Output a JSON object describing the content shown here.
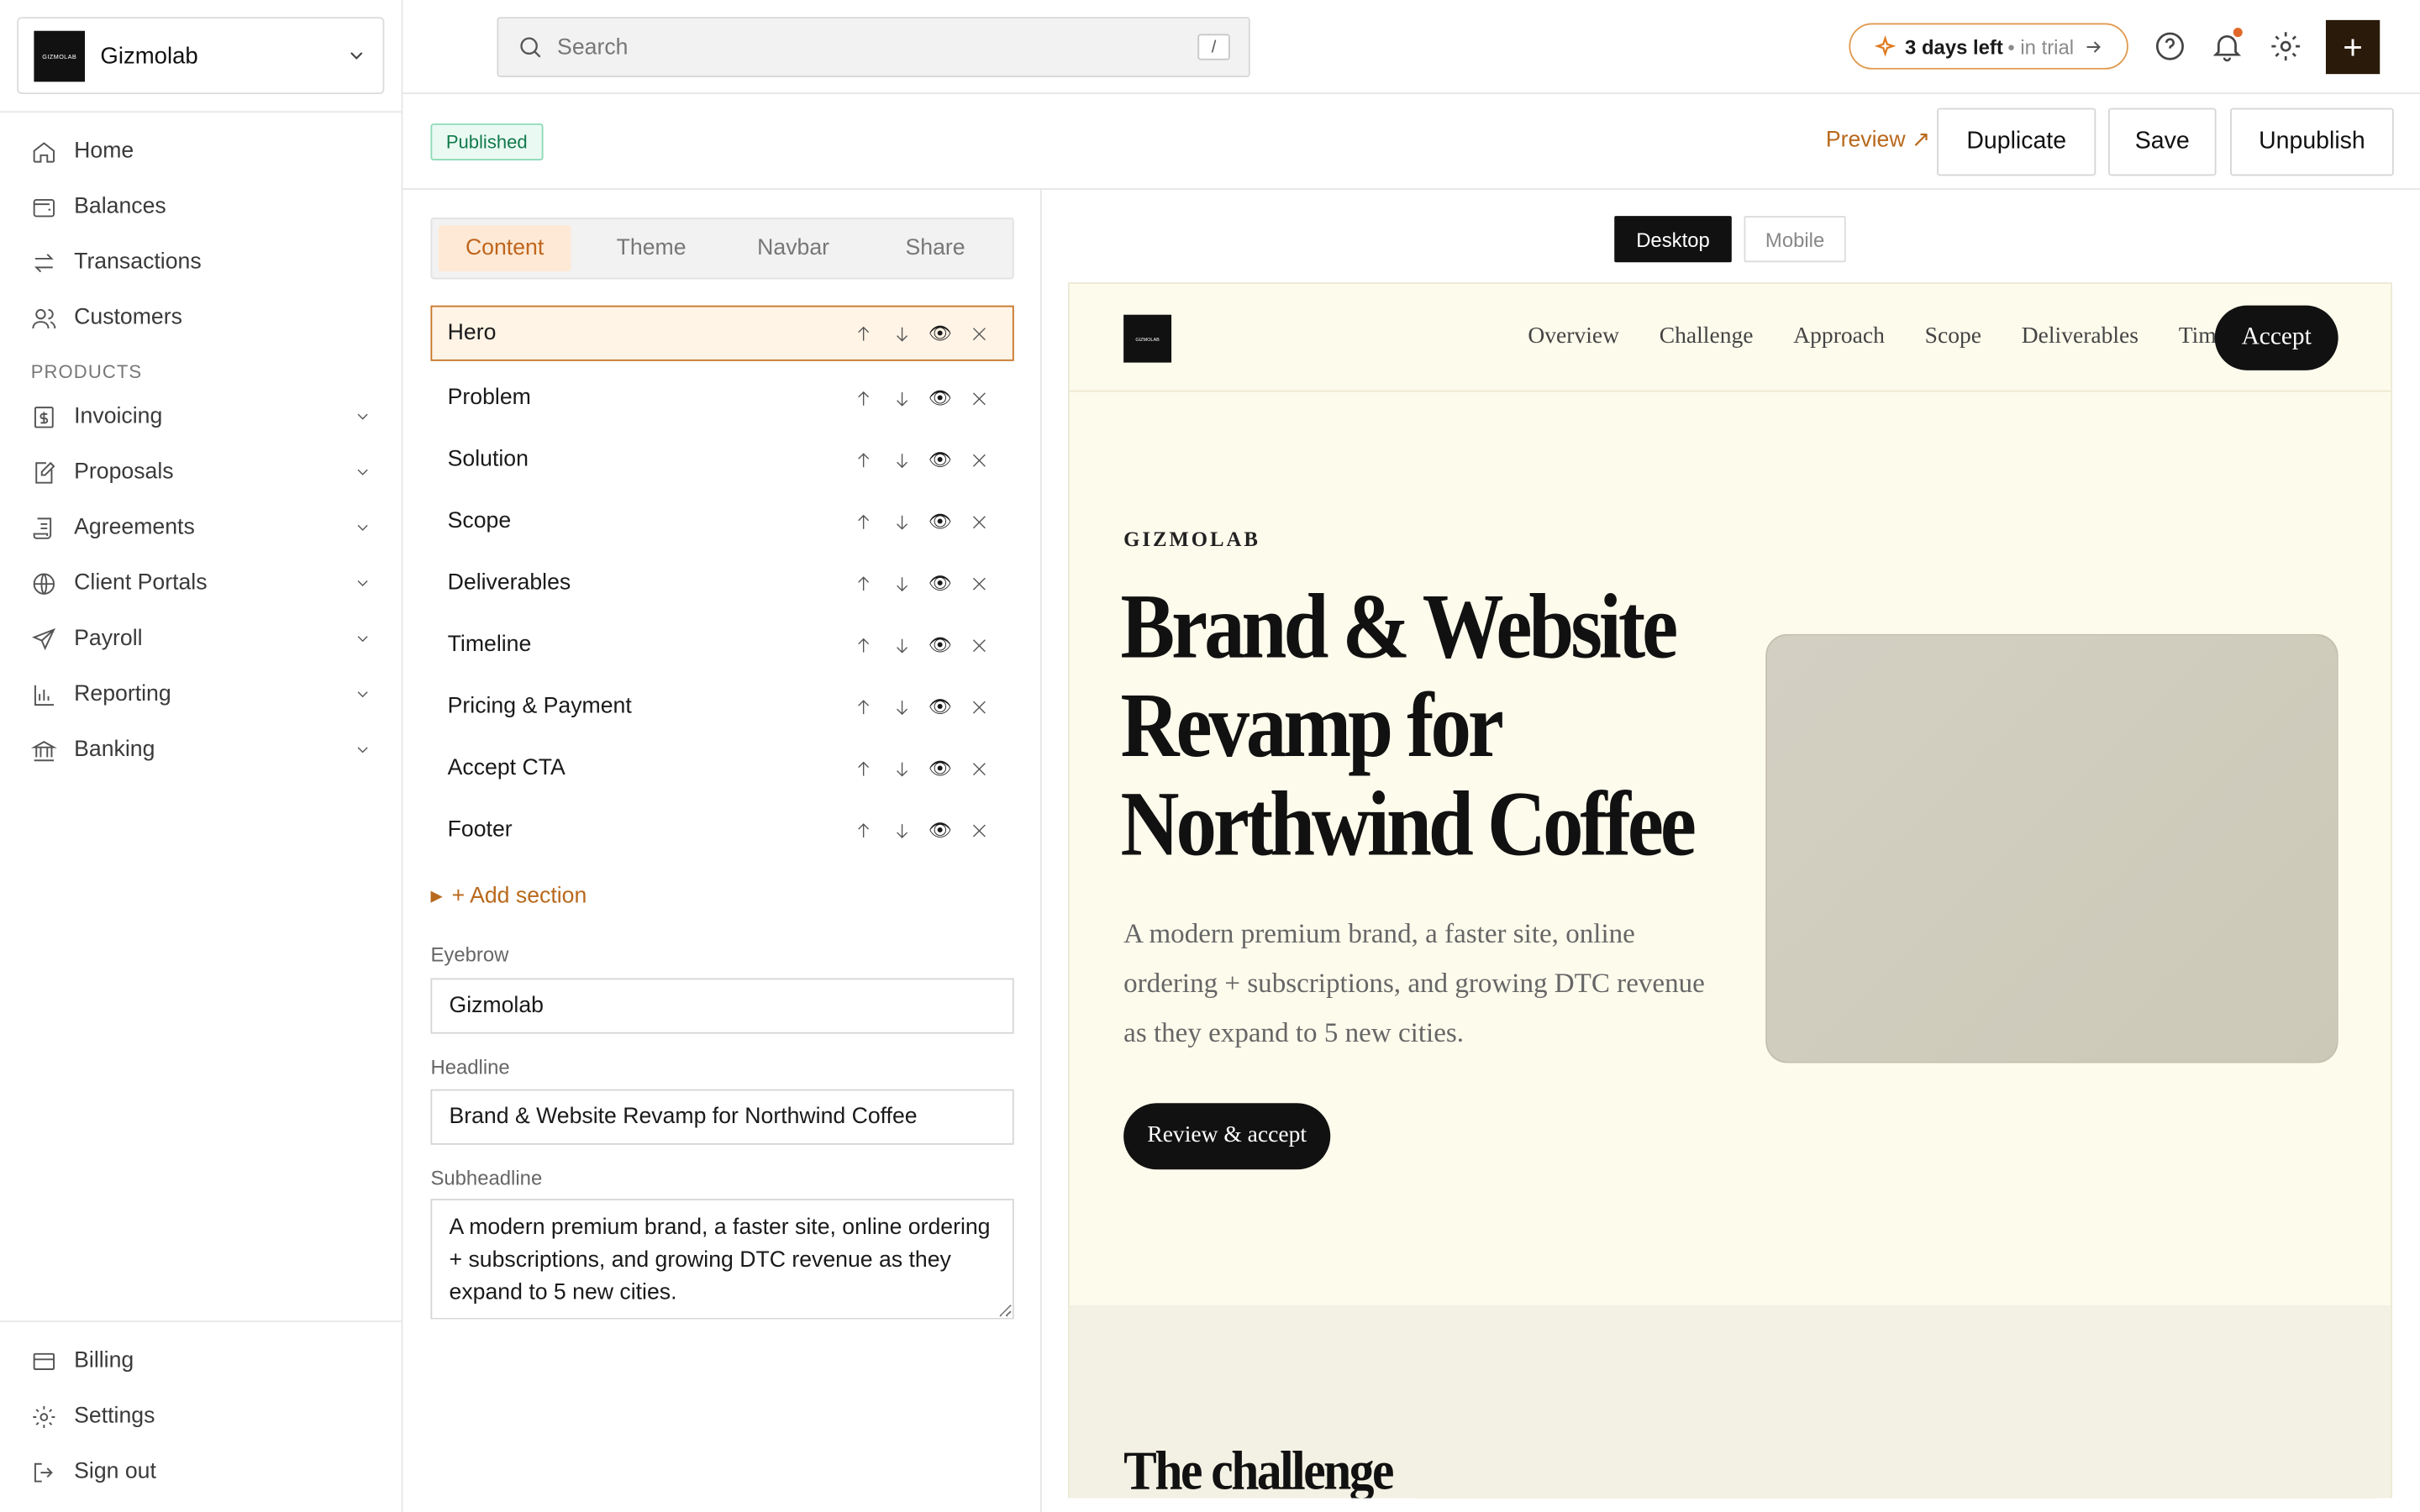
{
  "sidebar": {
    "org_logo_text": "GIZMOLAB",
    "org_name": "Gizmolab",
    "nav": [
      {
        "label": "Home",
        "icon": "home-icon"
      },
      {
        "label": "Balances",
        "icon": "wallet-icon"
      },
      {
        "label": "Transactions",
        "icon": "arrows-icon"
      },
      {
        "label": "Customers",
        "icon": "users-icon"
      }
    ],
    "products_heading": "PRODUCTS",
    "products": [
      {
        "label": "Invoicing",
        "icon": "dollar-icon"
      },
      {
        "label": "Proposals",
        "icon": "edit-doc-icon"
      },
      {
        "label": "Agreements",
        "icon": "scroll-icon"
      },
      {
        "label": "Client Portals",
        "icon": "globe-icon"
      },
      {
        "label": "Payroll",
        "icon": "send-icon"
      },
      {
        "label": "Reporting",
        "icon": "bar-chart-icon"
      },
      {
        "label": "Banking",
        "icon": "bank-icon"
      }
    ],
    "bottom": [
      {
        "label": "Billing",
        "icon": "card-icon"
      },
      {
        "label": "Settings",
        "icon": "gear-icon"
      },
      {
        "label": "Sign out",
        "icon": "logout-icon"
      }
    ]
  },
  "topbar": {
    "search_placeholder": "Search",
    "search_shortcut": "/",
    "trial_bold": "3 days left",
    "trial_rest": "• in trial",
    "plus": "+"
  },
  "subbar": {
    "status": "Published",
    "preview": "Preview ↗",
    "duplicate": "Duplicate",
    "save": "Save",
    "unpublish": "Unpublish"
  },
  "editor": {
    "tabs": [
      "Content",
      "Theme",
      "Navbar",
      "Share"
    ],
    "sections": [
      "Hero",
      "Problem",
      "Solution",
      "Scope",
      "Deliverables",
      "Timeline",
      "Pricing & Payment",
      "Accept CTA",
      "Footer"
    ],
    "add_section": "+ Add section",
    "eyebrow_label": "Eyebrow",
    "eyebrow_value": "Gizmolab",
    "headline_label": "Headline",
    "headline_value": "Brand & Website Revamp for Northwind Coffee",
    "subheadline_label": "Subheadline",
    "subheadline_value": "A modern premium brand, a faster site, online ordering + subscriptions, and growing DTC revenue as they expand to 5 new cities."
  },
  "preview": {
    "desktop": "Desktop",
    "mobile": "Mobile",
    "logo_text": "GIZMOLAB",
    "nav_links": [
      "Overview",
      "Challenge",
      "Approach",
      "Scope",
      "Deliverables",
      "Timeline"
    ],
    "accept": "Accept",
    "eyebrow": "GIZMOLAB",
    "headline": "Brand & Website Revamp for Northwind Coffee",
    "subheadline": "A modern premium brand, a faster site, online ordering + subscriptions, and growing DTC revenue as they expand to 5 new cities.",
    "cta": "Review & accept",
    "next_heading": "The challenge"
  },
  "colors": {
    "accent": "#c0661e",
    "preview_bg": "#fdfbec",
    "published_green": "#127a4a"
  }
}
